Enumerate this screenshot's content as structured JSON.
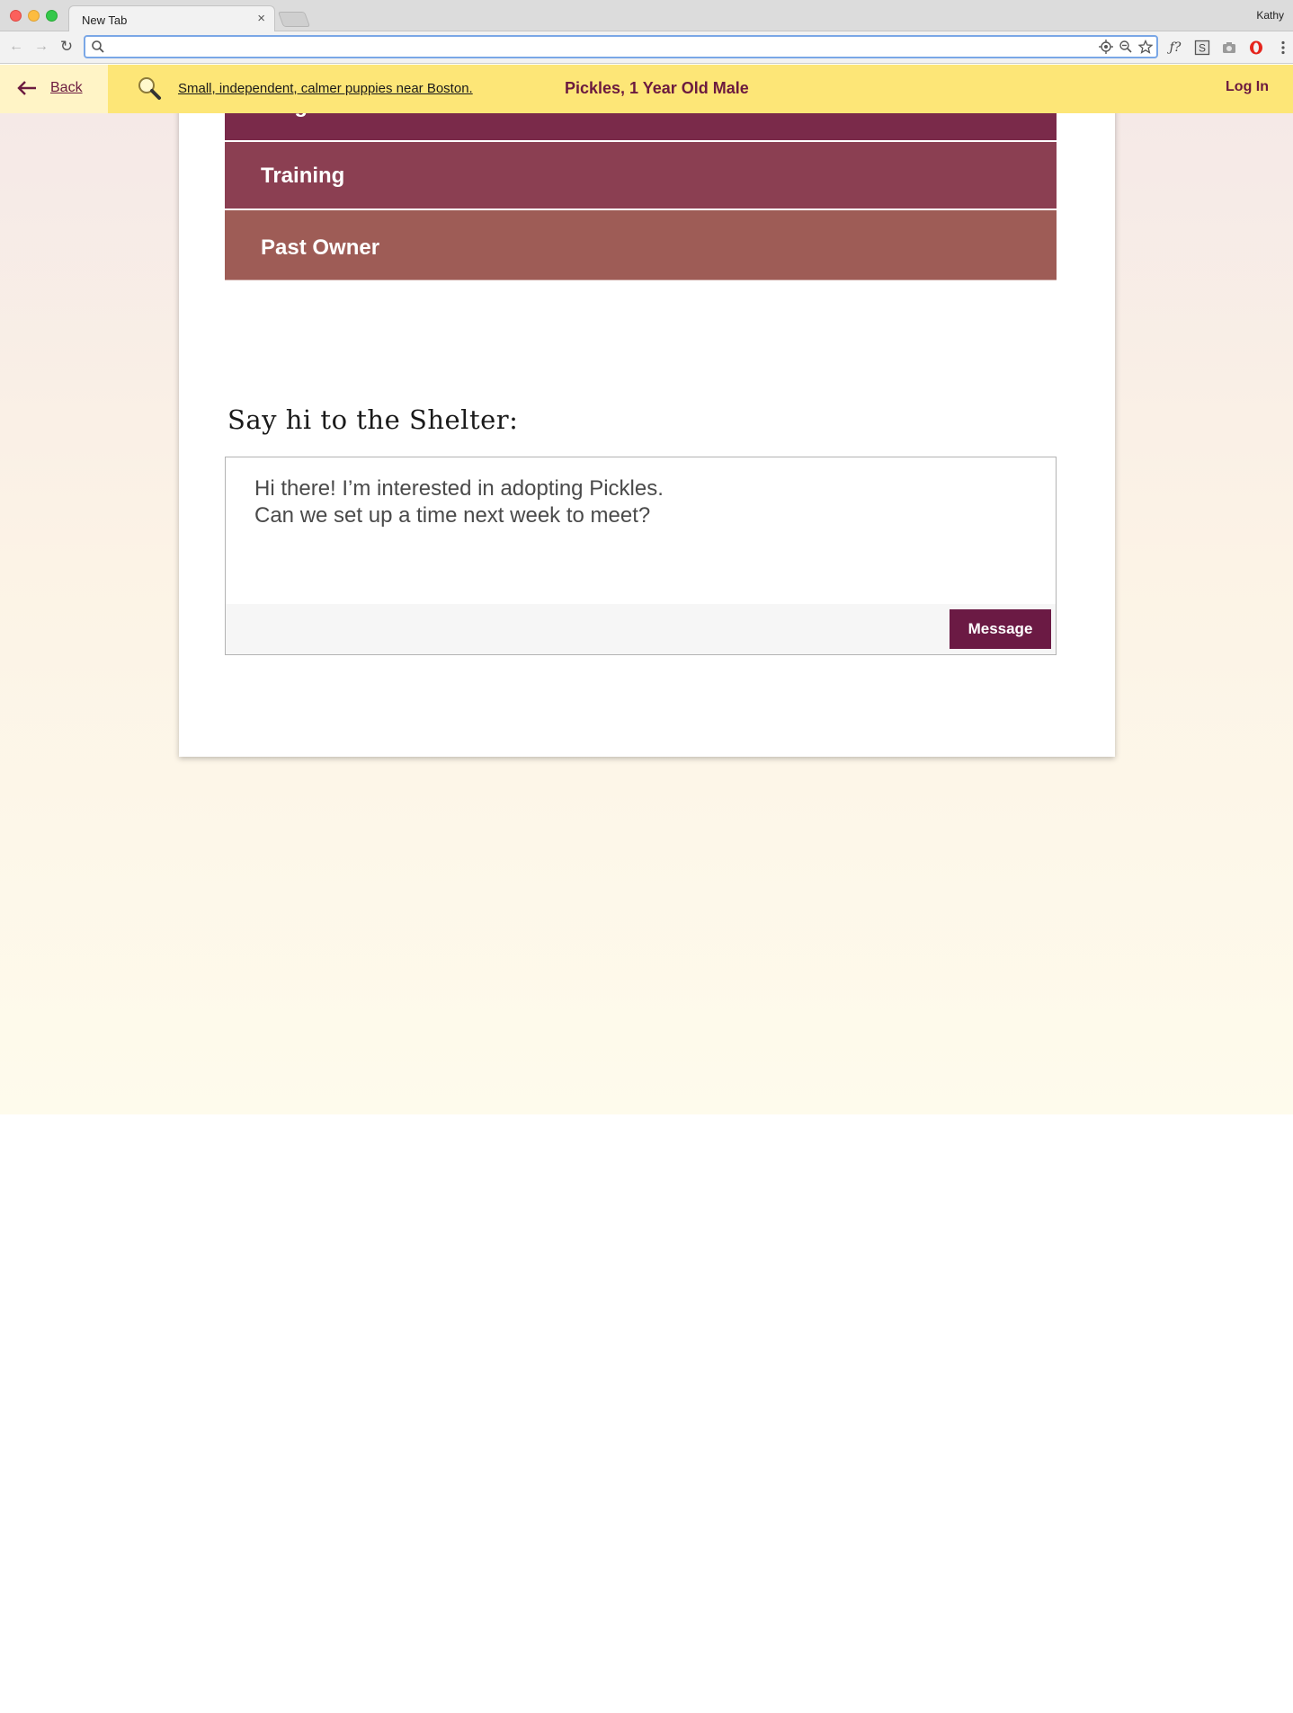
{
  "browser": {
    "tab_title": "New Tab",
    "tab_close": "×",
    "profile_name": "Kathy",
    "address_value": "",
    "ext_formula_label": "ƒ?",
    "ext_s_label": "S"
  },
  "header": {
    "back_label": "Back",
    "search_query": "Small, independent, calmer puppies near Boston.",
    "pet_title": "Pickles, 1 Year Old Male",
    "login_label": "Log In"
  },
  "accordion": {
    "items": [
      {
        "label": "Diagnoses"
      },
      {
        "label": "Training"
      },
      {
        "label": "Past Owner"
      }
    ]
  },
  "contact": {
    "heading": "Say hi to the Shelter:",
    "message_text": "Hi there! I’m interested in adopting Pickles.\nCan we set up a time next week to meet?",
    "send_label": "Message"
  },
  "colors": {
    "header_bg": "#fde677",
    "brand": "#6b1a3f",
    "diagnoses_bg": "#7a2a4a",
    "training_bg": "#8b3f52",
    "past_owner_bg": "#9e5c56",
    "button_bg": "#6b1a44"
  }
}
